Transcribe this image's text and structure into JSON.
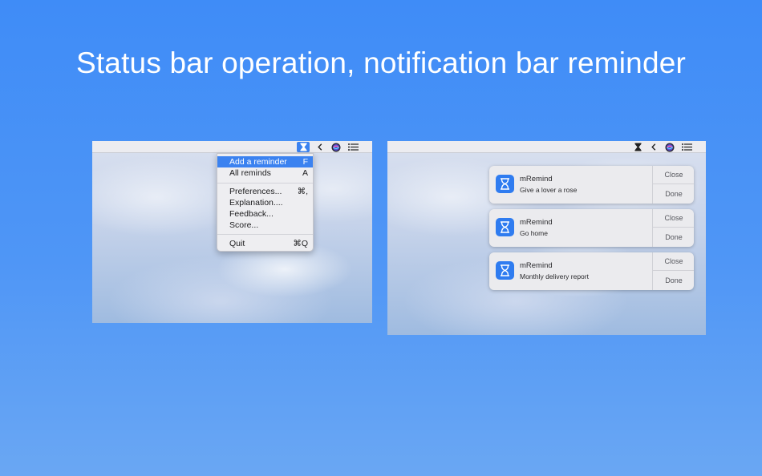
{
  "headline": "Status bar operation, notification bar reminder",
  "left_screen": {
    "menu": {
      "items": [
        {
          "label": "Add a reminder",
          "shortcut": "F"
        },
        {
          "label": "All reminds",
          "shortcut": "A"
        },
        {
          "label": "Preferences...",
          "shortcut": "⌘,"
        },
        {
          "label": "Explanation....",
          "shortcut": ""
        },
        {
          "label": "Feedback...",
          "shortcut": ""
        },
        {
          "label": "Score...",
          "shortcut": ""
        },
        {
          "label": "Quit",
          "shortcut": "⌘Q"
        }
      ],
      "highlighted": "Add a reminder"
    }
  },
  "right_screen": {
    "notifications": [
      {
        "app": "mRemind",
        "message": "Give a lover a rose",
        "close": "Close",
        "done": "Done"
      },
      {
        "app": "mRemind",
        "message": "Go home",
        "close": "Close",
        "done": "Done"
      },
      {
        "app": "mRemind",
        "message": "Monthly delivery report",
        "close": "Close",
        "done": "Done"
      }
    ]
  },
  "menubar_icons": [
    "hourglass-icon",
    "chevron-left-icon",
    "siri-icon",
    "list-icon"
  ],
  "colors": {
    "background": "#4f96f6",
    "menu_highlight": "#3b82f0",
    "app_icon": "#2f7cf0"
  }
}
